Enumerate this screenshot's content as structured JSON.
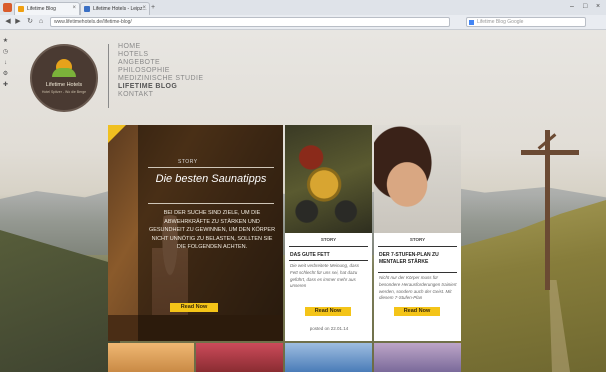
{
  "browser": {
    "tab1_title": "Lifetime Blog",
    "tab2_title": "Lifetime Hotels - Leipz...",
    "address": "www.lifetimehotels.de/lifetime-blog/",
    "search_placeholder": "Lifetime Blog Google",
    "buttons": {
      "back": "◀",
      "forward": "▶",
      "reload": "↻",
      "home": "⌂",
      "new_tab": "+",
      "minimize": "–",
      "maximize": "□",
      "close": "×"
    }
  },
  "logo": {
    "name": "Lifetime Hotels",
    "tagline": "Hotel Spitzer - Wo die Berge"
  },
  "menu": {
    "items": [
      "HOME",
      "HOTELS",
      "ANGEBOTE",
      "PHILOSOPHIE",
      "MEDIZINISCHE STUDIE",
      "LIFETIME BLOG",
      "KONTAKT"
    ],
    "active_index": 5
  },
  "featured": {
    "label": "STORY",
    "title": "Die besten Saunatipps",
    "text": "BEI DER SUCHE SIND ZIELE, UM DIE ABWEHRKRÄFTE ZU STÄRKEN UND GESUNDHEIT ZU GEWINNEN, UM DEN KÖRPER NICHT UNNÖTIG ZU BELASTEN, SOLLTEN SIE DIE FOLGENDEN ACHTEN.",
    "button": "Read Now"
  },
  "card_oil": {
    "label": "STORY",
    "title": "DAS GUTE FETT",
    "text": "Die weit verbreitete Meinung, dass Fett schlecht für uns sei, hat dazu geführt, dass es immer mehr aus unseren",
    "button": "Read Now",
    "posted": "posted on 22.01.14"
  },
  "card_person": {
    "label": "STORY",
    "title": "DER 7-STUFEN-PLAN ZU MENTALER STÄRKE",
    "text": "Nicht nur der Körper muss für besondere Herausforderungen trainiert werden, sondern auch der Geist. Mit diesem 7-Stufen-Plan",
    "button": "Read Now"
  },
  "icons": {
    "app": "browser-logo",
    "favicon": "site-favicon",
    "sidebar": [
      "bookmark-icon",
      "history-icon",
      "download-icon",
      "settings-icon",
      "addon-icon"
    ]
  }
}
